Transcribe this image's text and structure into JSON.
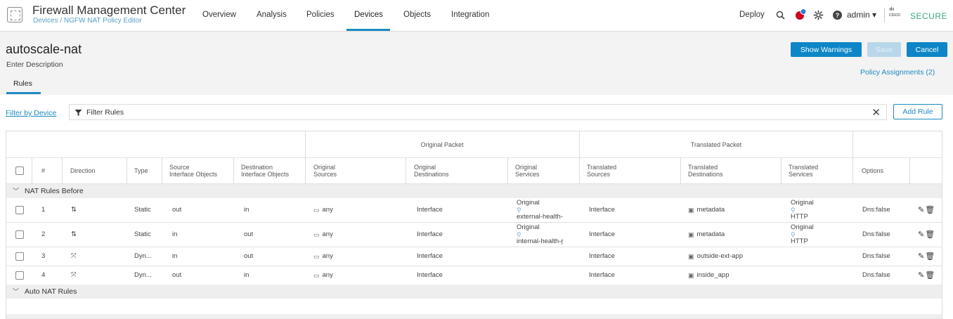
{
  "app": {
    "title": "Firewall Management Center",
    "breadcrumb": "Devices / NGFW NAT Policy Editor"
  },
  "nav": {
    "tabs": [
      "Overview",
      "Analysis",
      "Policies",
      "Devices",
      "Objects",
      "Integration"
    ],
    "active_tab": "Devices",
    "deploy": "Deploy",
    "admin": "admin ▾",
    "brand_cisco": "cisco",
    "brand_secure": "SECURE",
    "notification_count": "1"
  },
  "page": {
    "title": "autoscale-nat",
    "description": "Enter Description",
    "tab": "Rules",
    "buttons": {
      "show_warnings": "Show Warnings",
      "save": "Save",
      "cancel": "Cancel"
    },
    "policy_assignments": "Policy Assignments (2)"
  },
  "filter": {
    "by_device": "Filter by Device",
    "placeholder": "Filter Rules",
    "add_rule": "Add Rule"
  },
  "table": {
    "group_headers": {
      "original": "Original Packet",
      "translated": "Translated Packet"
    },
    "columns": {
      "num": "#",
      "direction": "Direction",
      "type": "Type",
      "src_if_1": "Source",
      "src_if_2": "Interface Objects",
      "dst_if_1": "Destination",
      "dst_if_2": "Interface Objects",
      "orig_src_1": "Original",
      "orig_src_2": "Sources",
      "orig_dst_1": "Original",
      "orig_dst_2": "Destinations",
      "orig_svc_1": "Original",
      "orig_svc_2": "Services",
      "tr_src_1": "Translated",
      "tr_src_2": "Sources",
      "tr_dst_1": "Translated",
      "tr_dst_2": "Destinations",
      "tr_svc_1": "Translated",
      "tr_svc_2": "Services",
      "options": "Options"
    },
    "sections": {
      "before": "NAT Rules Before",
      "auto": "Auto NAT Rules"
    },
    "rows": [
      {
        "num": "1",
        "direction": "⇅",
        "type": "Static",
        "src_if": "out",
        "dst_if": "in",
        "orig_src": "any",
        "orig_dst": "Interface",
        "orig_svc_1": "Original",
        "orig_svc_2": "external-health-",
        "tr_src": "Interface",
        "tr_dst": "metadata",
        "tr_svc_1": "Original",
        "tr_svc_2": "HTTP",
        "options": "Dns:false"
      },
      {
        "num": "2",
        "direction": "⇅",
        "type": "Static",
        "src_if": "in",
        "dst_if": "out",
        "orig_src": "any",
        "orig_dst": "Interface",
        "orig_svc_1": "Original",
        "orig_svc_2": "internal-health-ŗ",
        "tr_src": "Interface",
        "tr_dst": "metadata",
        "tr_svc_1": "Original",
        "tr_svc_2": "HTTP",
        "options": "Dns:false"
      },
      {
        "num": "3",
        "direction": "⤧",
        "type": "Dyn...",
        "src_if": "in",
        "dst_if": "out",
        "orig_src": "any",
        "orig_dst": "Interface",
        "orig_svc_1": "",
        "orig_svc_2": "",
        "tr_src": "Interface",
        "tr_dst": "outside-ext-app",
        "tr_svc_1": "",
        "tr_svc_2": "",
        "options": "Dns:false"
      },
      {
        "num": "4",
        "direction": "⤧",
        "type": "Dyn...",
        "src_if": "out",
        "dst_if": "in",
        "orig_src": "any",
        "orig_dst": "Interface",
        "orig_svc_1": "",
        "orig_svc_2": "",
        "tr_src": "Interface",
        "tr_dst": "inside_app",
        "tr_svc_1": "",
        "tr_svc_2": "",
        "options": "Dns:false"
      }
    ]
  },
  "colors": {
    "accent": "#1d8ac1",
    "primary_button": "#0d86c7",
    "brand_green": "#3aa77d",
    "notification": "#d0021b"
  }
}
